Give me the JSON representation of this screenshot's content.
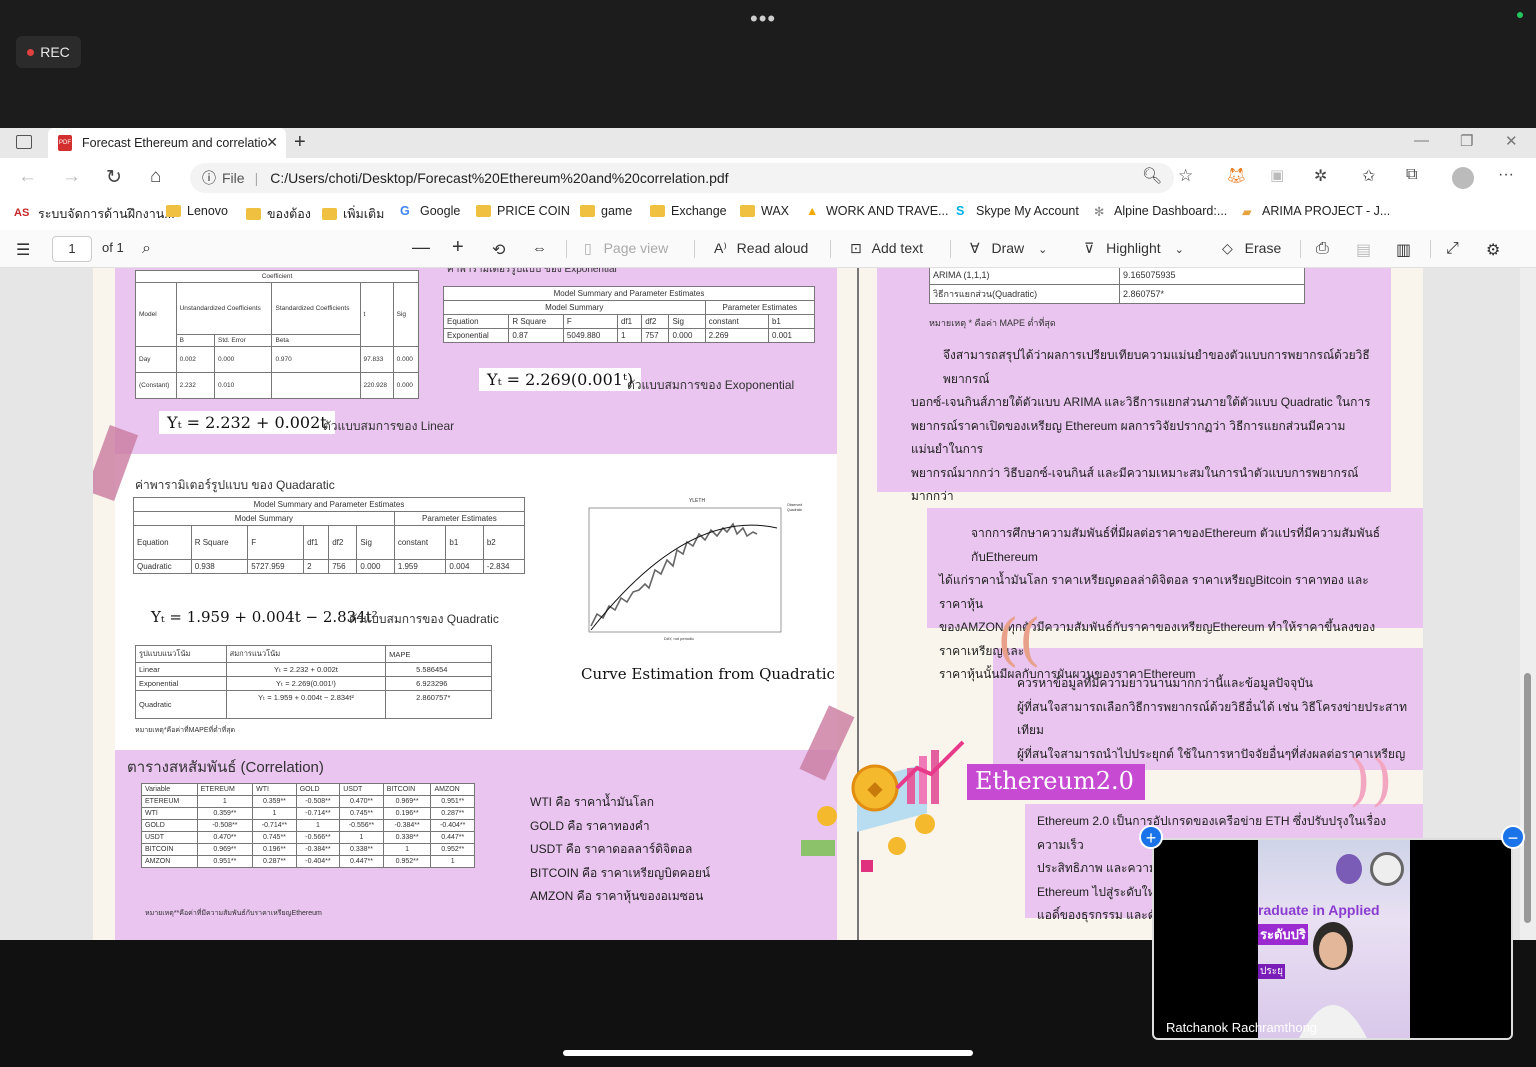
{
  "meeting": {
    "rec_label": "REC",
    "more_dots": "•••",
    "participant_name": "Ratchanok Rachramthong"
  },
  "browser": {
    "tab_title": "Forecast Ethereum and correlatio",
    "close": "✕",
    "new_tab": "+",
    "url_prefix": "File",
    "url": "C:/Users/choti/Desktop/Forecast%20Ethereum%20and%20correlation.pdf",
    "bookmarks": [
      {
        "label": "ระบบจัดการด้านฝึกงาน...",
        "icon": "as-icon"
      },
      {
        "label": "Lenovo",
        "icon": "folder-icon"
      },
      {
        "label": "ของต้อง",
        "icon": "folder-icon"
      },
      {
        "label": "เพิ่มเติม",
        "icon": "folder-icon"
      },
      {
        "label": "Google",
        "icon": "google-icon"
      },
      {
        "label": "PRICE COIN",
        "icon": "folder-icon"
      },
      {
        "label": "game",
        "icon": "folder-icon"
      },
      {
        "label": "Exchange",
        "icon": "folder-icon"
      },
      {
        "label": "WAX",
        "icon": "folder-icon"
      },
      {
        "label": "WORK AND TRAVE...",
        "icon": "warning-icon"
      },
      {
        "label": "Skype My Account",
        "icon": "skype-icon"
      },
      {
        "label": "Alpine Dashboard:...",
        "icon": "alpine-icon"
      },
      {
        "label": "ARIMA PROJECT - J...",
        "icon": "doc-icon"
      }
    ]
  },
  "pdf_toolbar": {
    "page_number": "1",
    "page_total": "of 1",
    "page_view": "Page view",
    "read_aloud": "Read aloud",
    "add_text": "Add text",
    "draw": "Draw",
    "highlight": "Highlight",
    "erase": "Erase"
  },
  "doc": {
    "linear_table": {
      "title": "Coefficient",
      "headers": [
        "Model",
        "Unstandardized Coefficients",
        "Standardized Coefficients",
        "t",
        "Sig"
      ],
      "subheaders": [
        "B",
        "Std. Error",
        "Beta"
      ],
      "rows": [
        [
          "Day",
          "0.002",
          "0.000",
          "0.970",
          "97.833",
          "0.000"
        ],
        [
          "(Constant)",
          "2.232",
          "0.010",
          "",
          "220.928",
          "0.000"
        ]
      ]
    },
    "linear_eq": "Yₜ = 2.232 + 0.002t",
    "linear_caption": "ตัวแบบสมการของ Linear",
    "exp_header_text": "ค่าพารามิเตอร์รูปแบบ ของ Exponential",
    "exp_table": {
      "title": "Model Summary and Parameter Estimates",
      "group1": "Model Summary",
      "group2": "Parameter Estimates",
      "headers": [
        "Equation",
        "R Square",
        "F",
        "df1",
        "df2",
        "Sig",
        "constant",
        "b1"
      ],
      "row": [
        "Exponential",
        "0.87",
        "5049.880",
        "1",
        "757",
        "0.000",
        "2.269",
        "0.001"
      ]
    },
    "exp_eq": "Yₜ = 2.269(0.001ᵗ)",
    "exp_caption": "ตัวแบบสมการของ Exoponential",
    "quad_title": "ค่าพารามิเตอร์รูปแบบ ของ Quadaratic",
    "quad_table": {
      "title": "Model Summary and Parameter Estimates",
      "group1": "Model Summary",
      "group2": "Parameter Estimates",
      "headers": [
        "Equation",
        "R Square",
        "F",
        "df1",
        "df2",
        "Sig",
        "constant",
        "b1",
        "b2"
      ],
      "row": [
        "Quadratic",
        "0.938",
        "5727.959",
        "2",
        "756",
        "0.000",
        "1.959",
        "0.004",
        "-2.834"
      ]
    },
    "quad_eq": "Yₜ = 1.959 + 0.004t − 2.834t²",
    "quad_caption": "ตัวแบบสมการของ Quadratic",
    "mape_table": {
      "headers": [
        "รูปแบบแนวโน้ม",
        "สมการแนวโน้ม",
        "MAPE"
      ],
      "rows": [
        [
          "Linear",
          "Yₜ = 2.232 + 0.002t",
          "5.586454"
        ],
        [
          "Exponential",
          "Yₜ = 2.269(0.001ᵗ)",
          "6.923296"
        ],
        [
          "Quadratic",
          "Yₜ = 1.959 + 0.004t − 2.834t²",
          "2.860757*"
        ]
      ],
      "note": "หมายเหตุ*คือค่าที่MAPEที่ต่ำที่สุด"
    },
    "curve_caption": "Curve Estimation from Quadratic",
    "mini_chart_title": "YLETH",
    "mini_chart_xlabel": "DAY, not periodic",
    "mini_chart_legend": [
      "Observed",
      "Quadratic"
    ],
    "arima_table": {
      "rows": [
        [
          "ARIMA (1,1,1)",
          "9.165075935"
        ],
        [
          "วิธีการแยกส่วน(Quadratic)",
          "2.860757*"
        ]
      ],
      "note": "หมายเหตุ * คือค่า MAPE ต่ำที่สุด"
    },
    "conclusion_lines": [
      "จึงสามารถสรุปได้ว่าผลการเปรียบเทียบความแม่นยำของตัวแบบการพยากรณ์ด้วยวิธีพยากรณ์",
      "บอกซ์-เจนกินส์ภายใต้ตัวแบบ ARIMA และวิธีการแยกส่วนภายใต้ตัวแบบ Quadratic ในการ",
      "พยากรณ์ราคาเปิดของเหรียญ Ethereum ผลการวิจัยปรากฏว่า วิธีการแยกส่วนมีความแม่นยำในการ",
      "พยากรณ์มากกว่า วิธีบอกซ์-เจนกินส์ และมีความเหมาะสมในการนำตัวแบบการพยากรณ์มากกว่า"
    ],
    "corr_lines": [
      "จากการศึกษาความสัมพันธ์ที่มีผลต่อราคาของEthereum ตัวแปรที่มีความสัมพันธ์กับEthereum",
      "ได้แก่ราคาน้ำมันโลก ราคาเหรียญดอลล่าดิจิตอล ราคาเหรียญBitcoin ราคาทอง และ ราคาหุ้น",
      "ของAMZON ทุกตัวมีความสัมพันธ์กับราคาของเหรียญEthereum ทำให้ราคาขึ้นลงของราคาเหรียญและ",
      "ราคาหุ้นนั้นมีผลกับการผันผวนของราคาEthereum"
    ],
    "suggest_lines": [
      "ควรหาข้อมูลที่มีความยาวนานมากกว่านี้และข้อมูลปัจจุบัน",
      "ผู้ที่สนใจสามารถเลือกวิธีการพยากรณ์ด้วยวิธีอื่นได้ เช่น วิธีโครงข่ายประสาทเทียม",
      "ผู้ที่สนใจสามารถนำไปประยุกต์ ใช้ในการหาปัจจัยอื่นๆที่ส่งผลต่อราคาเหรียญ Ethereum"
    ],
    "eth2_title": "Ethereum2.0",
    "eth2_lines": [
      "Ethereum 2.0 เป็นการอัปเกรดของเครือข่าย ETH ซึ่งปรับปรุงในเรื่องความเร็ว",
      "ประสิทธิภาพ และความ",
      "Ethereum ไปสู่ระดับใหม",
      "แอดิ์ของธุรกรรม และดั"
    ],
    "corr_title": "ตารางสหสัมพันธ์ (Correlation)",
    "corr_table": {
      "headers": [
        "Variable",
        "ETEREUM",
        "WTI",
        "GOLD",
        "USDT",
        "BITCOIN",
        "AMZON"
      ],
      "rows": [
        [
          "ETEREUM",
          "1",
          "0.359**",
          "-0.508**",
          "0.470**",
          "0.969**",
          "0.951**"
        ],
        [
          "WTI",
          "0.359**",
          "1",
          "-0.714**",
          "0.745**",
          "0.196**",
          "0.287**"
        ],
        [
          "GOLD",
          "-0.508**",
          "-0.714**",
          "1",
          "-0.556**",
          "-0.384**",
          "-0.404**"
        ],
        [
          "USDT",
          "0.470**",
          "0.745**",
          "-0.566**",
          "1",
          "0.338**",
          "0.447**"
        ],
        [
          "BITCOIN",
          "0.969**",
          "0.196**",
          "-0.384**",
          "0.338**",
          "1",
          "0.952**"
        ],
        [
          "AMZON",
          "0.951**",
          "0.287**",
          "-0.404**",
          "0.447**",
          "0.952**",
          "1"
        ]
      ],
      "note": "หมายเหตุ**คือค่าที่มีความสัมพันธ์กับราคาเหรียญEthereum"
    },
    "legend_lines": [
      "WTI คือ ราคาน้ำมันโลก",
      "GOLD คือ ราคาทองคำ",
      "USDT คือ ราคาดอลลาร์ดิจิตอล",
      "BITCOIN คือ ราคาเหรียญบิตคอยน์",
      "AMZON คือ ราคาหุ้นของอเมซอน"
    ],
    "video_sign_text": [
      "raduate in Applied",
      "ระดับปริ",
      "ประยุ"
    ]
  },
  "colors": {
    "pink": "#e9c5ef",
    "accent_blue": "#1a73e8",
    "rec_red": "#e04040"
  }
}
